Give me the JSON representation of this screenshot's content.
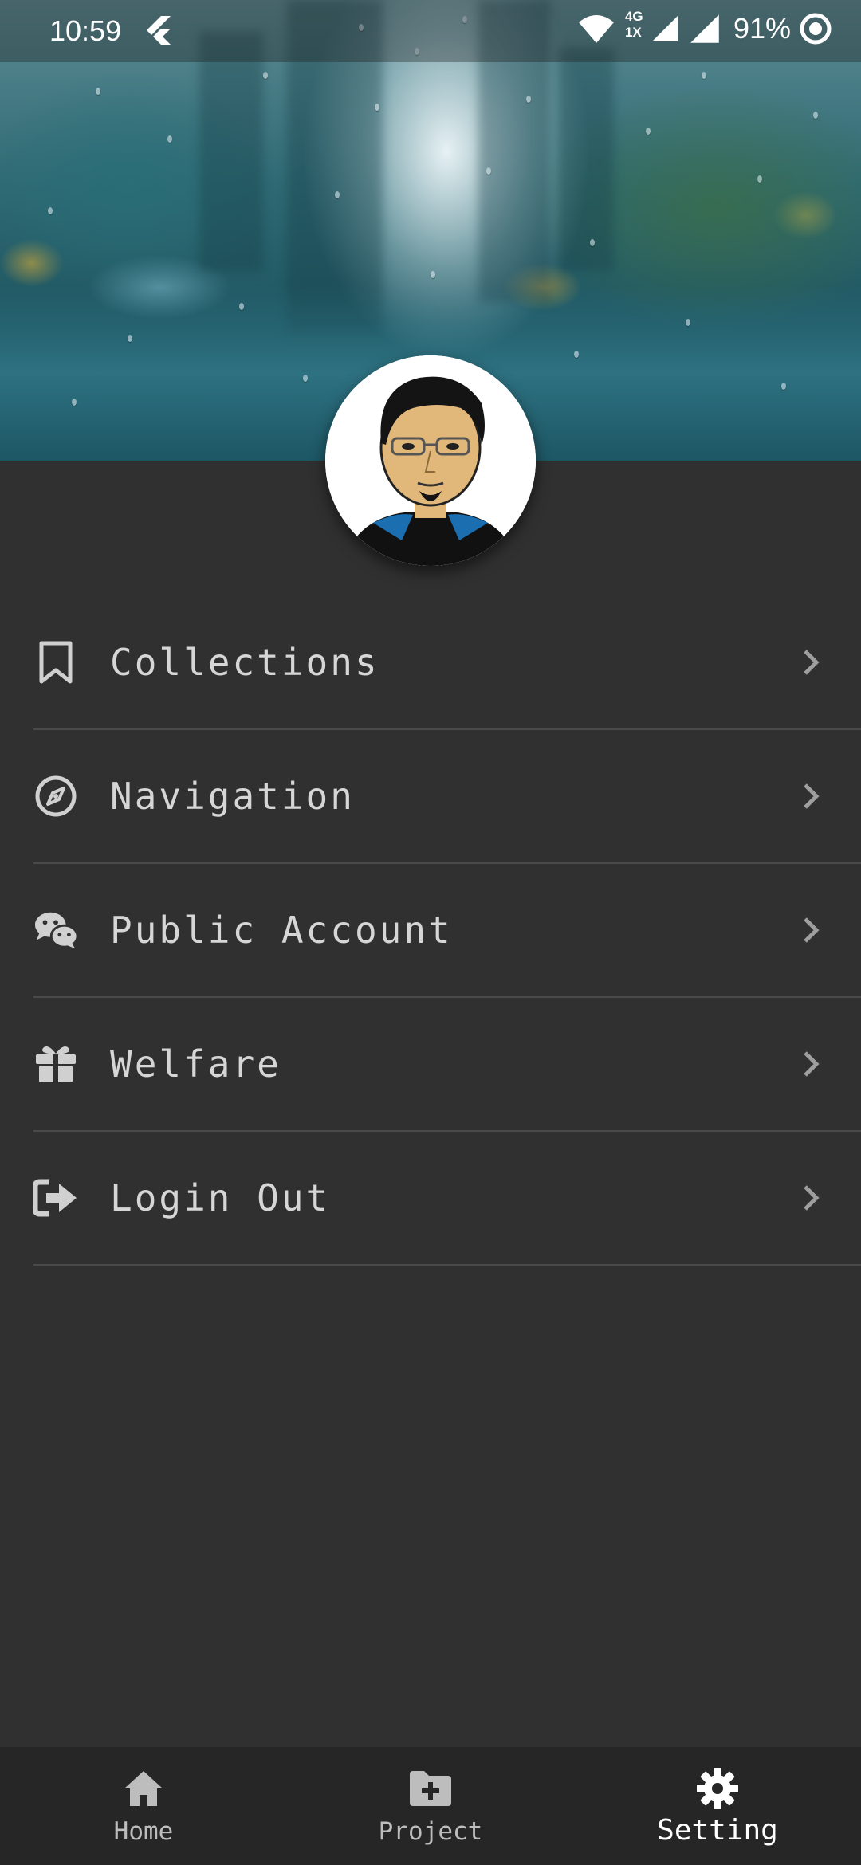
{
  "status_bar": {
    "time": "10:59",
    "network_badge_top": "4G",
    "network_badge_bottom": "1X",
    "battery_percent": "91%",
    "icons": [
      "flutter-icon",
      "wifi-icon",
      "signal-icon",
      "signal-icon",
      "sync-icon"
    ]
  },
  "menu": {
    "items": [
      {
        "label": "Collections",
        "icon": "bookmark-icon"
      },
      {
        "label": "Navigation",
        "icon": "compass-icon"
      },
      {
        "label": "Public Account",
        "icon": "wechat-icon"
      },
      {
        "label": "Welfare",
        "icon": "gift-icon"
      },
      {
        "label": "Login Out",
        "icon": "sign-out-icon"
      }
    ]
  },
  "bottom_nav": {
    "tabs": [
      {
        "label": "Home",
        "icon": "home-icon",
        "active": false
      },
      {
        "label": "Project",
        "icon": "folder-plus-icon",
        "active": false
      },
      {
        "label": "Setting",
        "icon": "gear-icon",
        "active": true
      }
    ]
  },
  "colors": {
    "background": "#303030",
    "bottom_nav_background": "#262626",
    "menu_text": "#d6d6d6",
    "icon": "#d0d0d0",
    "divider": "#4a4a4a",
    "chevron": "#9e9e9e"
  }
}
